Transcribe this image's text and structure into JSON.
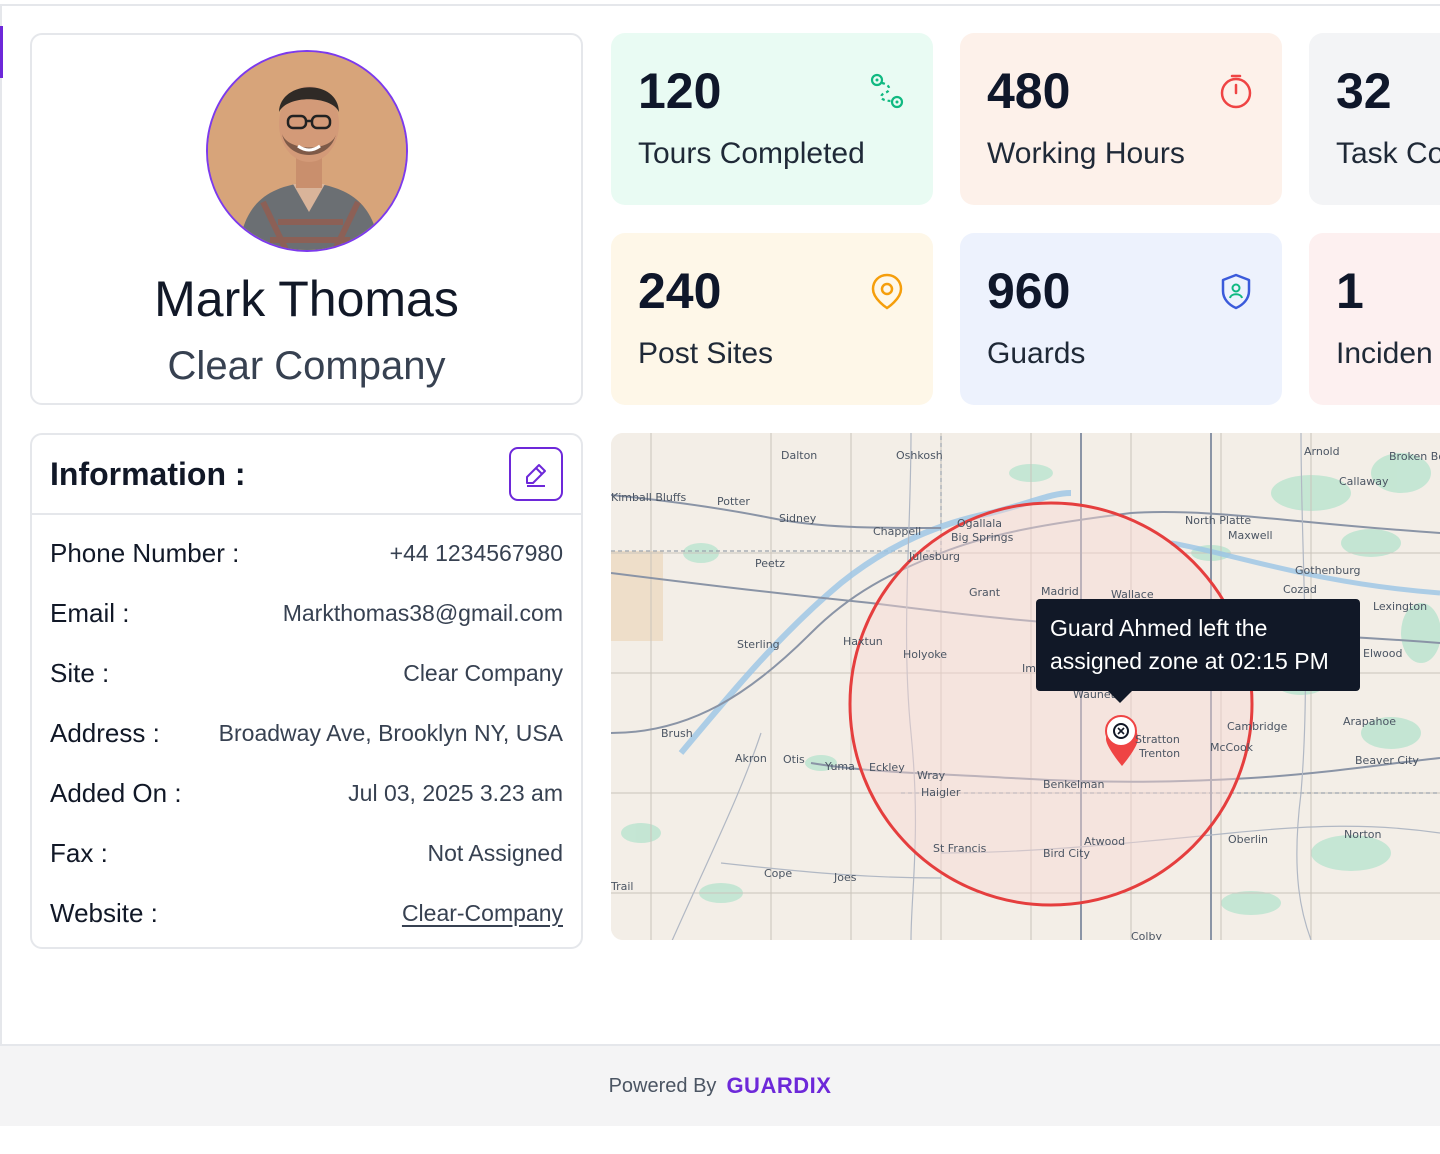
{
  "profile": {
    "name": "Mark Thomas",
    "company": "Clear Company"
  },
  "stats": [
    {
      "value": "120",
      "label": "Tours Completed",
      "icon": "route-icon",
      "color": "#10b981",
      "bg": "#e9fbf3"
    },
    {
      "value": "480",
      "label": "Working Hours",
      "icon": "timer-icon",
      "color": "#ef4444",
      "bg": "#fdf1ea"
    },
    {
      "value": "32",
      "label": "Task Co",
      "icon": "",
      "color": "#6b7280",
      "bg": "#f3f4f6"
    },
    {
      "value": "240",
      "label": "Post Sites",
      "icon": "location-pin-icon",
      "color": "#f59e0b",
      "bg": "#fef7e8"
    },
    {
      "value": "960",
      "label": "Guards",
      "icon": "shield-user-icon",
      "color": "#3b5bdb",
      "bg": "#edf2fd"
    },
    {
      "value": "1",
      "label": "Inciden",
      "icon": "",
      "color": "#ef4444",
      "bg": "#fdf0f0"
    }
  ],
  "information": {
    "title": "Information :",
    "rows": [
      {
        "label": "Phone Number :",
        "value": "+44 1234567980"
      },
      {
        "label": "Email :",
        "value": "Markthomas38@gmail.com"
      },
      {
        "label": "Site :",
        "value": "Clear Company"
      },
      {
        "label": "Address :",
        "value": "Broadway Ave, Brooklyn NY, USA"
      },
      {
        "label": "Added On :",
        "value": "Jul 03, 2025 3.23 am"
      },
      {
        "label": "Fax :",
        "value": "Not Assigned"
      },
      {
        "label": "Website :",
        "value": "Clear-Company"
      }
    ]
  },
  "map": {
    "tooltip_line1": "Guard Ahmed left the",
    "tooltip_line2": "assigned zone at 02:15 PM",
    "zone_color": "#e53e3e",
    "labels": [
      "Dalton",
      "Oshkosh",
      "Arnold",
      "Broken Bo",
      "Callaway",
      "Kimball Bluffs",
      "Potter",
      "Sidney",
      "Chappell",
      "Ogallala",
      "Big Springs",
      "Julesburg",
      "Peetz",
      "North Platte",
      "Maxwell",
      "Gothenburg",
      "Cozad",
      "Lexington",
      "Grant",
      "Madrid",
      "Wallace",
      "Sterling",
      "Haxtun",
      "Holyoke",
      "Imperial",
      "Wauneta",
      "Stratton",
      "Trenton",
      "Cambridge",
      "McCook",
      "Arapahoe",
      "Beaver City",
      "Brush",
      "Akron",
      "Otis",
      "Yuma",
      "Eckley",
      "Wray",
      "Haigler",
      "Benkelman",
      "St Francis",
      "Bird City",
      "Atwood",
      "Oberlin",
      "Norton",
      "Cope",
      "Joes",
      "Trail",
      "Colby",
      "Elwood"
    ]
  },
  "footer": {
    "powered_by": "Powered By",
    "brand": "GUARDIX"
  }
}
